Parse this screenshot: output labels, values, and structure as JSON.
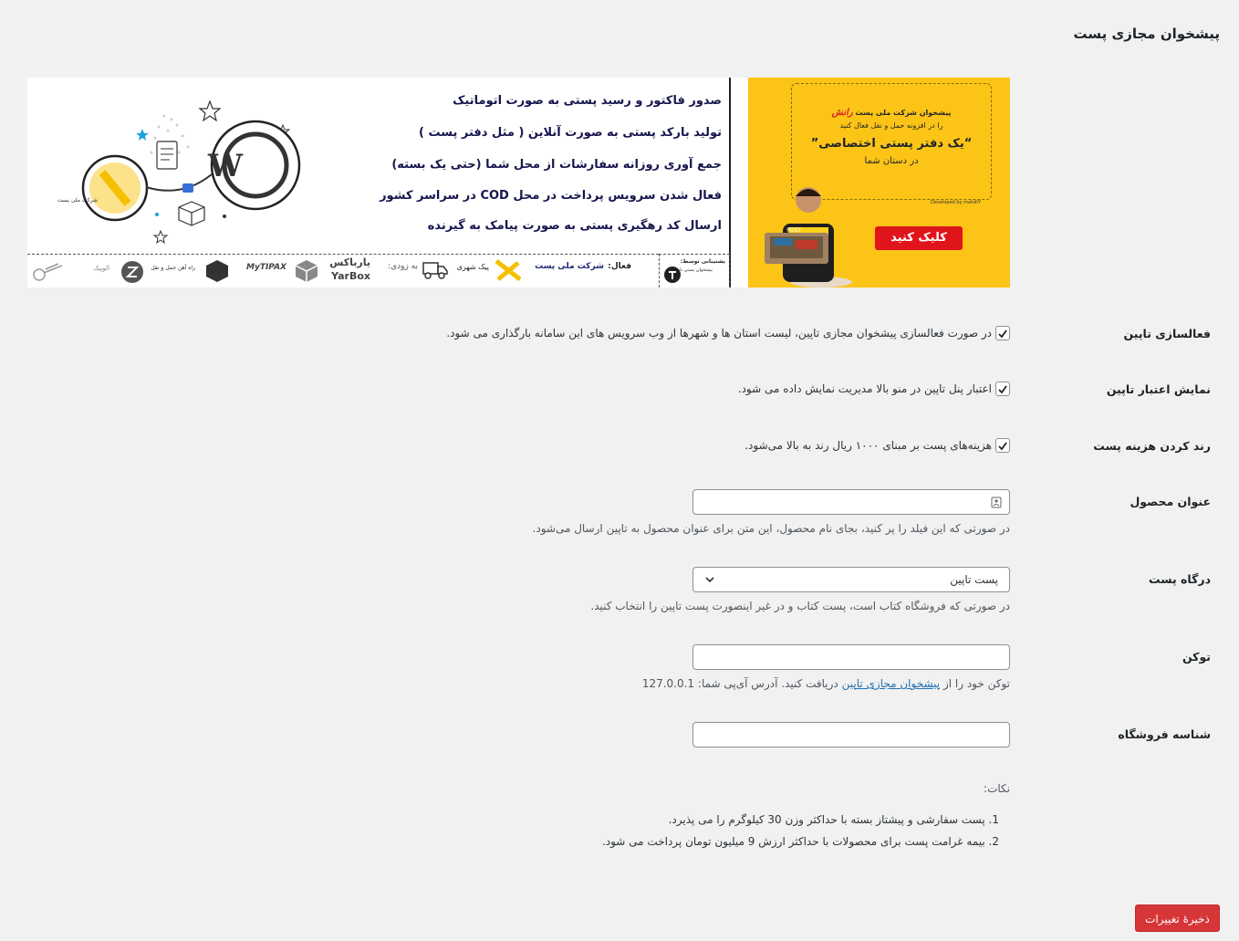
{
  "page": {
    "title": "پیشخوان مجازی پست"
  },
  "banner": {
    "features": [
      "صدور فاکتور و رسید پستی به صورت اتوماتیک",
      "تولید بارکد پستی به صورت آنلاین ( مثل دفتر پست )",
      "جمع آوری روزانه سفارشات از محل شما (حتی یک بسته)",
      "فعال شدن سرویس پرداخت در محل COD در سراسر کشور",
      "ارسال کد رهگیری پستی به صورت پیامک به گیرنده"
    ],
    "ad": {
      "line1": "پیشخوان شرکت ملی پست",
      "brand": "رانش",
      "line2": "را در افزونه حمل و نقل فعال کنید",
      "line3": "“یک دفتر پستی اختصاصی”",
      "line4": "در دستان شما",
      "developer": "Developed by mahdiY",
      "button": "کلیک کنید"
    },
    "support_label": "پشتیبانی توسط:",
    "support_name": "پیشخوان پستی تاپین",
    "support_url": "tapin.ir",
    "active_label": "فعال:",
    "post_company": "شرکت ملی پست",
    "courier": "پیک شهری",
    "coming_soon": "به زودی:",
    "yarbox_fa": "یارباکس",
    "yarbox_en": "YarBox",
    "mytipax": "MyTIPAX",
    "rail": "راه آهن حمل و نقل",
    "alopeyk": "الوپیک"
  },
  "fields": {
    "activate": {
      "label": "فعالسازی تاپین",
      "checked": true,
      "description": "در صورت فعالسازی پیشخوان مجازی تاپین، لیست استان ها و شهرها از وب سرویس های این سامانه بارگذاری می شود."
    },
    "show_credit": {
      "label": "نمایش اعتبار تاپین",
      "checked": true,
      "description": "اعتبار پنل تاپین در منو بالا مدیریت نمایش داده می شود."
    },
    "round_cost": {
      "label": "رند کردن هزینه پست",
      "checked": true,
      "description": "هزینه‌های پست بر مبنای ۱۰۰۰ ریال رند به بالا می‌شود."
    },
    "product_title": {
      "label": "عنوان محصول",
      "value": "",
      "help": "در صورتی که این فیلد را پر کنید، بجای نام محصول، این متن برای عنوان محصول به تاپین ارسال می‌شود."
    },
    "gateway": {
      "label": "درگاه پست",
      "value": "پست تاپین",
      "help": "در صورتی که فروشگاه کتاب است، پست کتاب و در غیر اینصورت پست تاپین را انتخاب کنید."
    },
    "token": {
      "label": "توکن",
      "value": "",
      "help_before": "توکن خود را از",
      "help_link": "پیشخوان مجازی تاپین",
      "help_after": "دریافت کنید. آدرس آی‌پی شما:",
      "ip": "127.0.0.1"
    },
    "shop_id": {
      "label": "شناسه فروشگاه",
      "value": ""
    }
  },
  "notes": {
    "title": "نکات:",
    "items": [
      "1. پست سفارشی و پیشتاز بسته با حداکثر وزن 30 کیلوگرم را می پذیرد.",
      "2. بیمه غرامت پست برای محصولات با حداکثر ارزش 9 میلیون تومان پرداخت می شود."
    ]
  },
  "actions": {
    "save_label": "ذخیرهٔ تغییرات"
  },
  "colors": {
    "primary_button": "#d63638",
    "link": "#2271b1",
    "banner_yellow": "#fcc417"
  }
}
